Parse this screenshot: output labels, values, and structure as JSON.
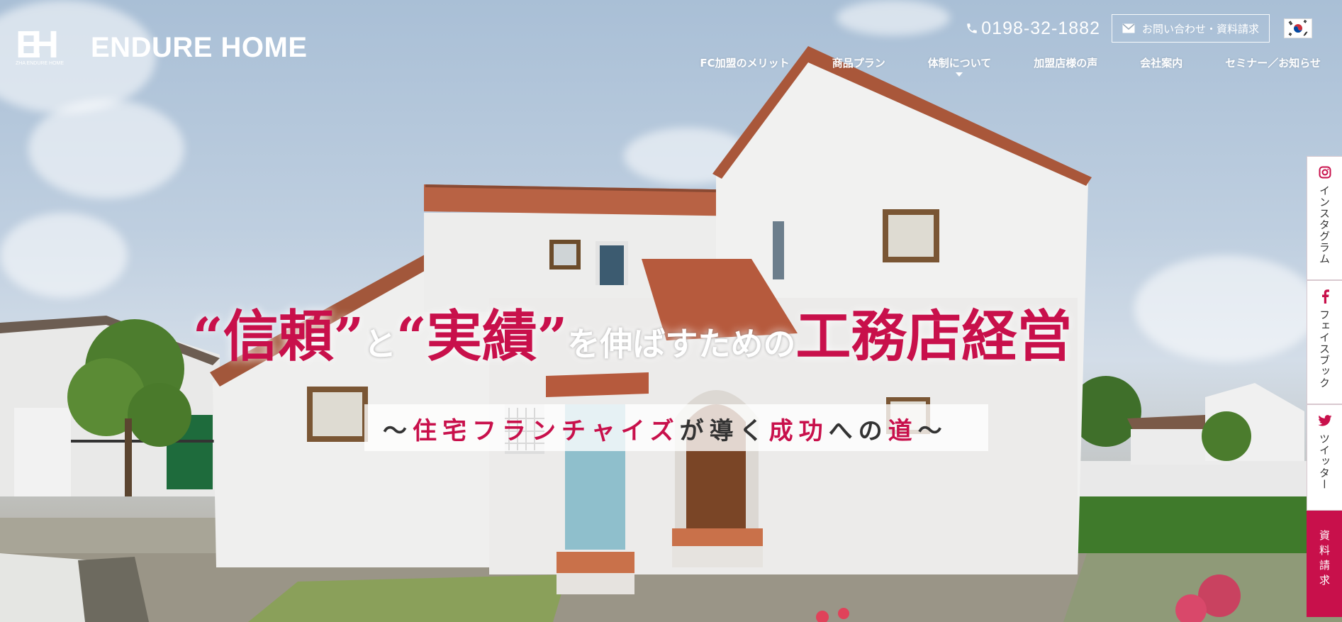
{
  "brand": {
    "logo_mark": "EH",
    "logo_small": "ZHA ENDURE HOME",
    "name": "ENDURE HOME"
  },
  "contact": {
    "phone": "0198-32-1882",
    "inquiry_label": "お問い合わせ・資料請求",
    "language_flag": "korea-flag-icon"
  },
  "nav": {
    "items": [
      {
        "label": "FC加盟のメリット"
      },
      {
        "label": "商品プラン"
      },
      {
        "label": "体制について",
        "has_dropdown": true
      },
      {
        "label": "加盟店様の声"
      },
      {
        "label": "会社案内"
      },
      {
        "label": "セミナー／お知らせ"
      }
    ]
  },
  "hero": {
    "headline": {
      "q1_open": "“",
      "word1": "信頼",
      "q1_close": "”",
      "to": "と",
      "q2_open": "“",
      "word2": "実績",
      "q2_close": "”",
      "middle": "を伸ばすための",
      "word3": "工務店経営"
    },
    "subline": {
      "tilde_open": "～",
      "part1": "住宅フランチャイズ",
      "part2": "が導く",
      "part3": "成功",
      "part4": "への",
      "part5": "道",
      "tilde_close": "～"
    }
  },
  "side_tabs": [
    {
      "label": "インスタグラム",
      "icon": "instagram-icon"
    },
    {
      "label": "フェイスブック",
      "icon": "facebook-icon"
    },
    {
      "label": "ツイッター",
      "icon": "twitter-icon"
    },
    {
      "label": "資料請求",
      "icon": ""
    }
  ],
  "colors": {
    "accent": "#c8104b",
    "text_dark": "#333333",
    "white": "#ffffff"
  }
}
